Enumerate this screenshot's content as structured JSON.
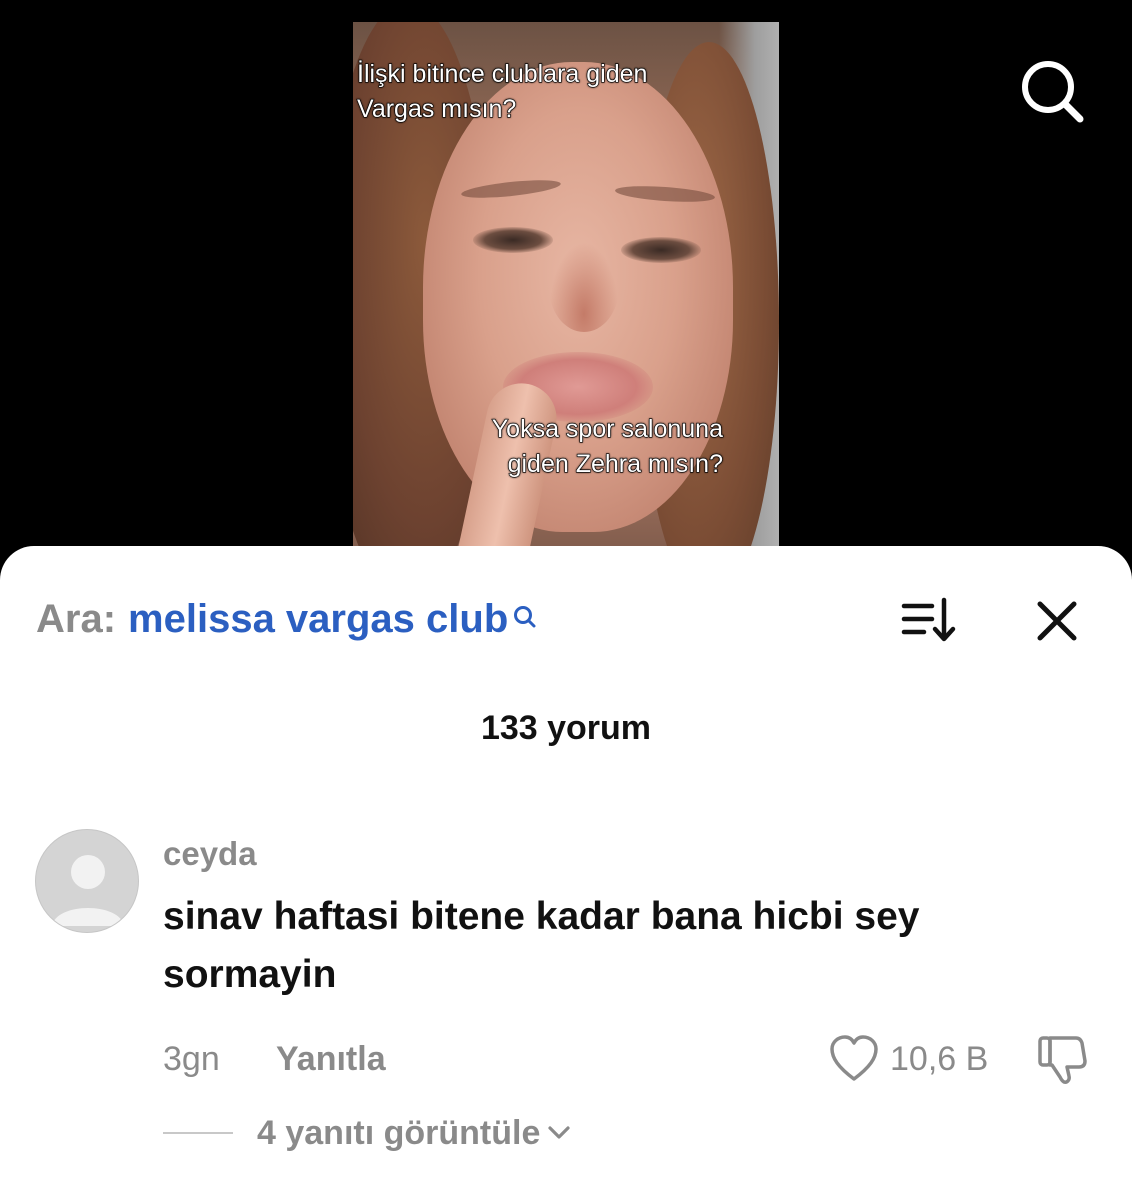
{
  "video": {
    "overlay_top": "İlişki bitince clublara giden\nVargas mısın?",
    "overlay_bottom": "Yoksa spor salonuna\ngiden Zehra mısın?"
  },
  "icons": {
    "top_search": "search-icon",
    "sort": "sort-icon",
    "close": "close-icon",
    "like": "heart-icon",
    "dislike": "thumbs-down-icon",
    "chevron": "chevron-down-icon",
    "mini_search": "search-icon"
  },
  "colors": {
    "query": "#2b5fc1",
    "muted": "#8a8a8a",
    "text": "#111111",
    "sheet": "#ffffff",
    "background": "#000000"
  },
  "search": {
    "prefix": "Ara:",
    "query": "melissa vargas club"
  },
  "comments": {
    "count_label": "133 yorum",
    "items": [
      {
        "username": "ceyda",
        "text": "sinav haftasi bitene kadar bana hicbi sey sormayin",
        "time": "3gn",
        "reply_label": "Yanıtla",
        "likes": "10,6 B",
        "view_replies_label": "4 yanıtı görüntüle"
      }
    ]
  }
}
